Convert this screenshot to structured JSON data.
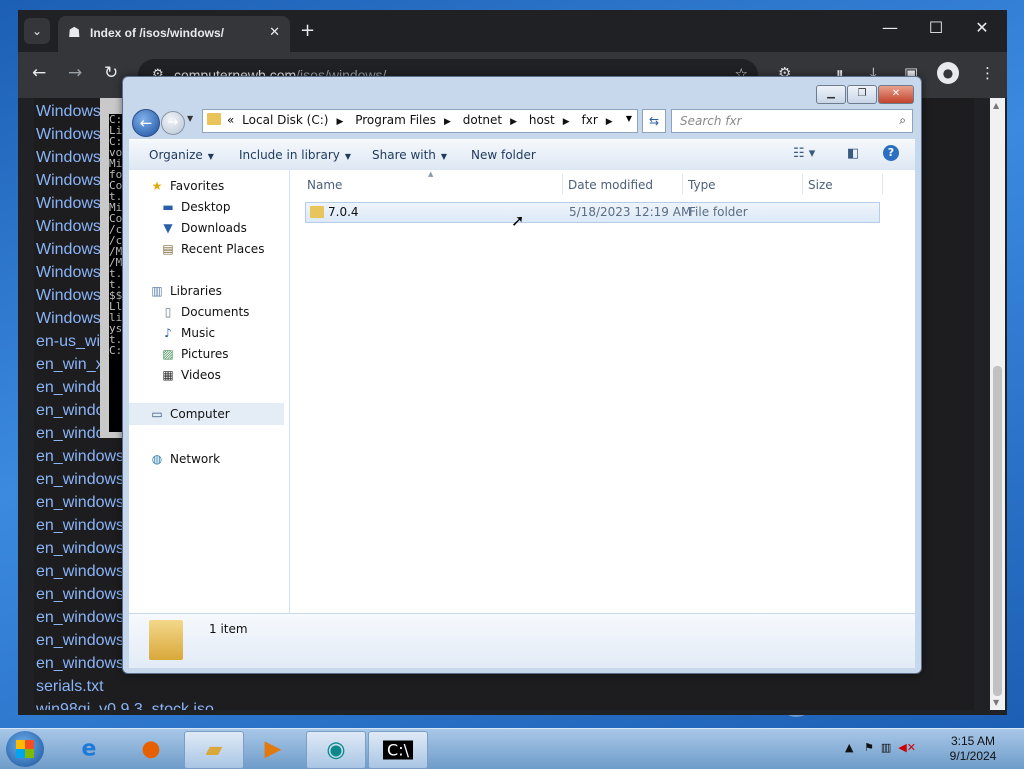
{
  "browser": {
    "tab_title": "Index of /isos/windows/",
    "url_domain": "computernewb.com",
    "url_path": "/isos/windows/",
    "listing": [
      "Windows",
      "Windows",
      "Windows",
      "Windows",
      "Windows",
      "Windows",
      "Windows",
      "Windows",
      "Windows",
      "Windows",
      "en-us_win",
      "en_win_x",
      "en_windo",
      "en_windo",
      "en_windo",
      "en_windows",
      "en_windows",
      "en_windows",
      "en_windows",
      "en_windows",
      "en_windows",
      "en_windows",
      "en_windows",
      "en_windows",
      "en_windows",
      "serials.txt",
      "win98qi_v0.9.3_stock.iso"
    ]
  },
  "cmd": {
    "lines": [
      "C:\\",
      "Li",
      "C:",
      "vo",
      "Mi",
      "fo",
      "Co",
      "t.",
      "Mi",
      "Co",
      "/c",
      "/c",
      "/M",
      "/M",
      "t.",
      "t.",
      "$$",
      "Ll",
      "li",
      "ys",
      "t.",
      "C:"
    ]
  },
  "explorer": {
    "breadcrumb": [
      "Local Disk (C:)",
      "Program Files",
      "dotnet",
      "host",
      "fxr"
    ],
    "breadcrumb_prefix": "«",
    "search_placeholder": "Search fxr",
    "commands": {
      "organize": "Organize",
      "include": "Include in library",
      "share": "Share with",
      "new_folder": "New folder"
    },
    "nav": {
      "favorites": "Favorites",
      "desktop": "Desktop",
      "downloads": "Downloads",
      "recent": "Recent Places",
      "libraries": "Libraries",
      "documents": "Documents",
      "music": "Music",
      "pictures": "Pictures",
      "videos": "Videos",
      "computer": "Computer",
      "network": "Network"
    },
    "columns": {
      "name": "Name",
      "date": "Date modified",
      "type": "Type",
      "size": "Size"
    },
    "rows": [
      {
        "name": "7.0.4",
        "date": "5/18/2023 12:19 AM",
        "type": "File folder",
        "size": ""
      }
    ],
    "status": "1 item"
  },
  "taskbar": {
    "time": "3:15 AM",
    "date": "9/1/2024"
  },
  "colors": {
    "accent": "#1a73e8",
    "link": "#8ab4f8",
    "folder": "#e8c45a"
  }
}
